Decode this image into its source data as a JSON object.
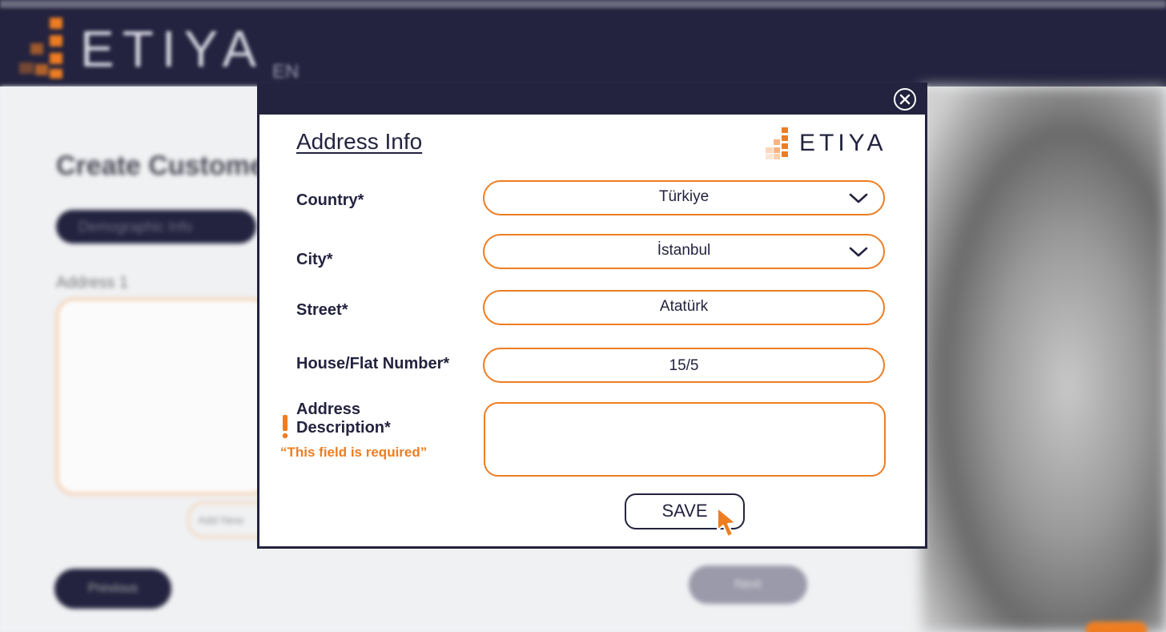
{
  "background": {
    "brand": "ETIYA",
    "language": "EN",
    "page_title": "Create Customer",
    "demographic_tab": "Demographic Info",
    "address_label": "Address 1",
    "add_new_label": "Add New",
    "previous_label": "Previous",
    "next_label": "Next"
  },
  "modal": {
    "title": "Address Info",
    "logo_text": "ETIYA",
    "close_icon": "close-circle-icon",
    "fields": {
      "country": {
        "label": "Country*",
        "value": "Türkiye",
        "icon": "chevron-down-icon"
      },
      "city": {
        "label": "City*",
        "value": "İstanbul",
        "icon": "chevron-down-icon"
      },
      "street": {
        "label": "Street*",
        "value": "Atatürk"
      },
      "house": {
        "label": "House/Flat Number*",
        "value": "15/5"
      },
      "description": {
        "label_line1": "Address",
        "label_line2": "Description*",
        "value": "",
        "error": "“This field is required”",
        "error_icon": "exclamation-icon"
      }
    },
    "save_label": "SAVE",
    "cursor_icon": "pointer-cursor-icon"
  },
  "colors": {
    "navy": "#23233f",
    "orange": "#ee7d22",
    "white": "#ffffff"
  }
}
